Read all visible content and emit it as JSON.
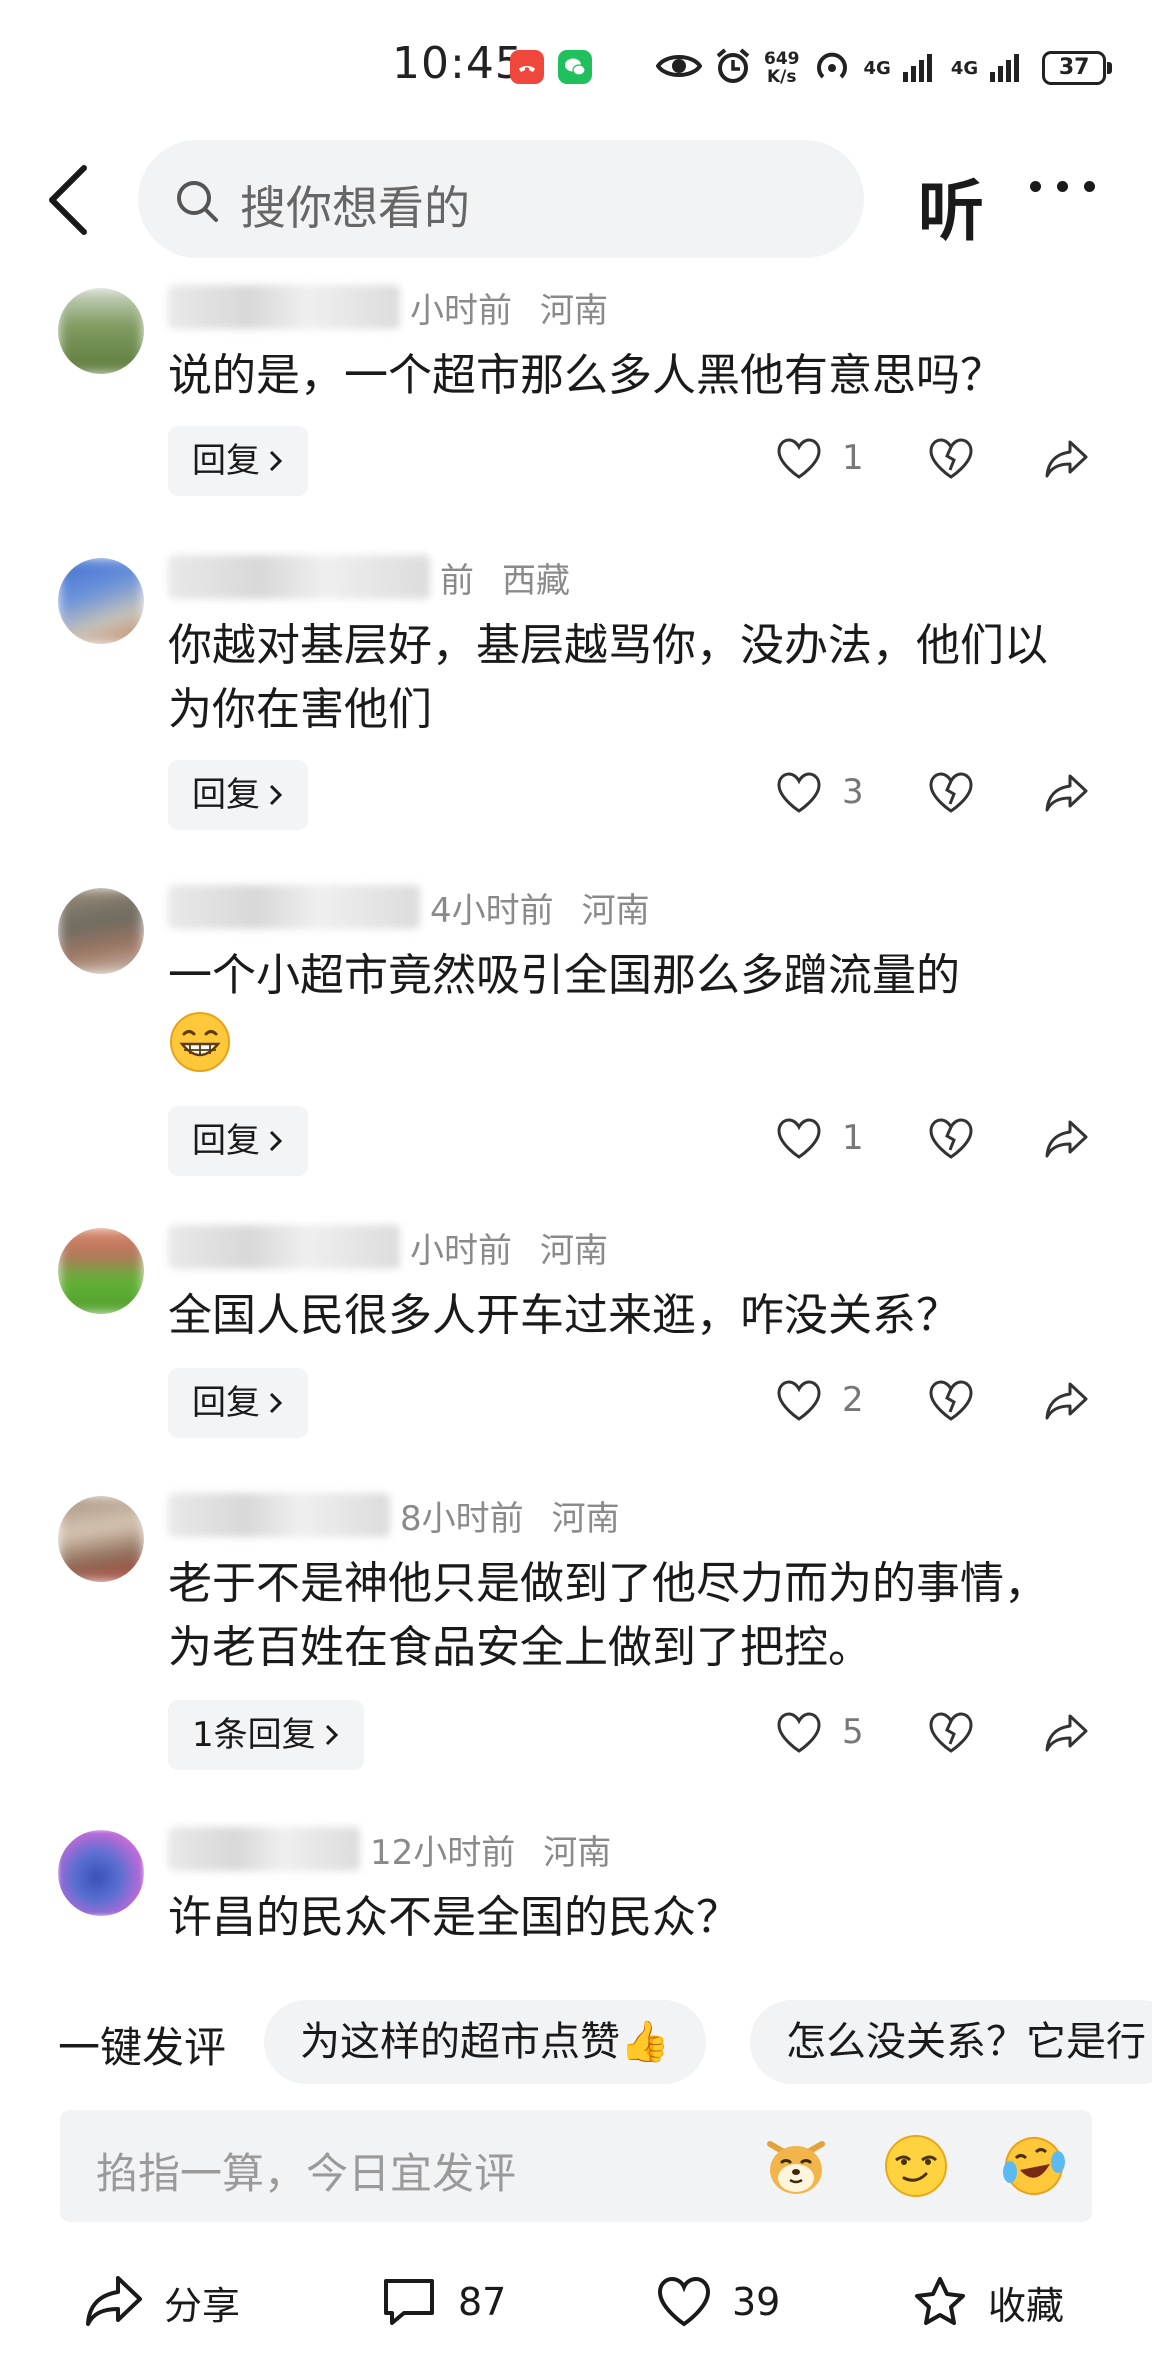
{
  "status_bar": {
    "time": "10:45",
    "speed_value": "649",
    "speed_unit": "K/s",
    "net1": "4G",
    "net2": "4G",
    "battery": "37"
  },
  "header": {
    "search_placeholder": "搜你想看的",
    "listen_label": "听"
  },
  "comments": [
    {
      "time": "小时前",
      "location": "河南",
      "text": "说的是，一个超市那么多人黑他有意思吗？",
      "reply_label": "回复",
      "likes": "1"
    },
    {
      "time": "前",
      "location": "西藏",
      "text": "你越对基层好，基层越骂你，没办法，他们以为你在害他们",
      "reply_label": "回复",
      "likes": "3"
    },
    {
      "time": "4小时前",
      "location": "河南",
      "text": "一个小超市竟然吸引全国那么多蹭流量的",
      "reply_label": "回复",
      "likes": "1"
    },
    {
      "time": "小时前",
      "location": "河南",
      "text": "全国人民很多人开车过来逛，咋没关系？",
      "reply_label": "回复",
      "likes": "2"
    },
    {
      "time": "8小时前",
      "location": "河南",
      "text": "老于不是神他只是做到了他尽力而为的事情，为老百姓在食品安全上做到了把控。",
      "reply_label": "1条回复",
      "likes": "5"
    },
    {
      "time": "12小时前",
      "location": "河南",
      "text": "许昌的民众不是全国的民众？"
    }
  ],
  "quick_comment": {
    "label": "一键发评",
    "chips": [
      "为这样的超市点赞👍",
      "怎么没关系？它是行"
    ]
  },
  "input": {
    "placeholder": "掐指一算，今日宜发评"
  },
  "toolbar": {
    "share_label": "分享",
    "comment_count": "87",
    "like_count": "39",
    "fav_label": "收藏"
  }
}
